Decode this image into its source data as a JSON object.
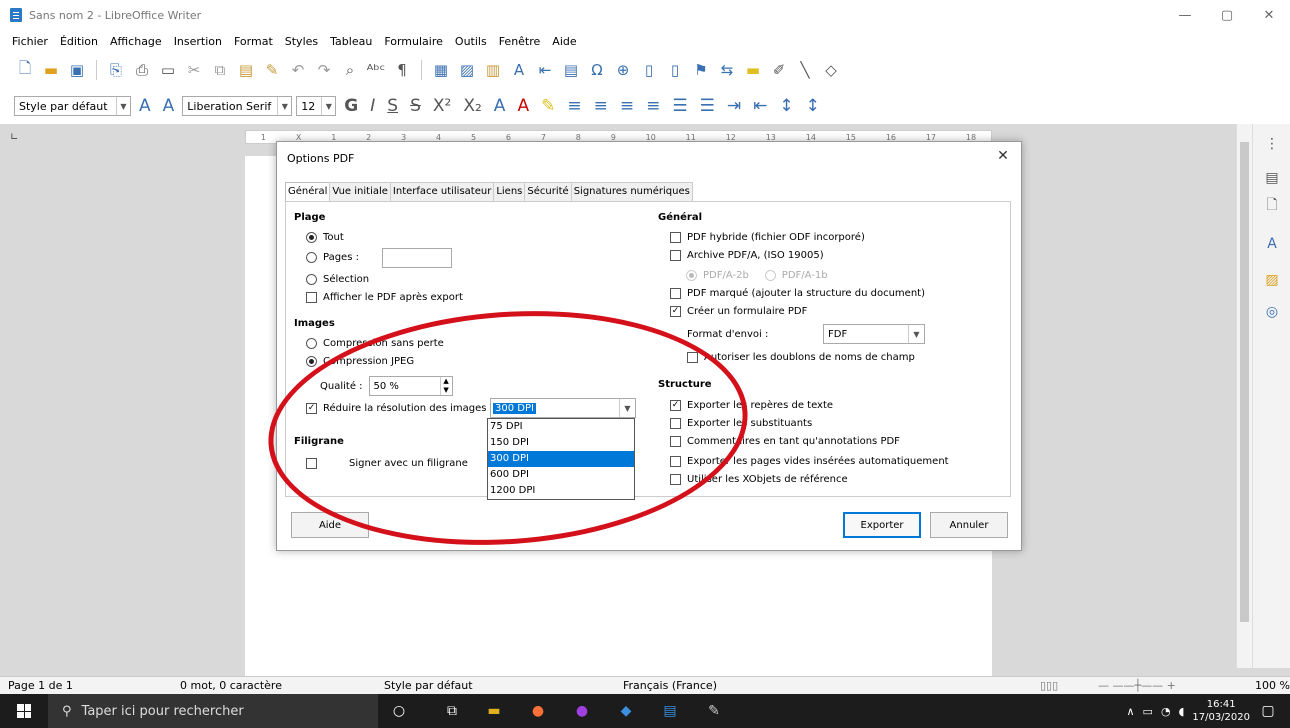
{
  "window": {
    "title": "Sans nom 2 - LibreOffice Writer",
    "min": "—",
    "max": "▢",
    "close": "✕"
  },
  "menu": [
    "Fichier",
    "Édition",
    "Affichage",
    "Insertion",
    "Format",
    "Styles",
    "Tableau",
    "Formulaire",
    "Outils",
    "Fenêtre",
    "Aide"
  ],
  "formatbar": {
    "style": "Style par défaut",
    "font": "Liberation Serif",
    "size": "12"
  },
  "ruler": [
    "1",
    "X",
    "1",
    "2",
    "3",
    "4",
    "5",
    "6",
    "7",
    "8",
    "9",
    "10",
    "11",
    "12",
    "13",
    "14",
    "15",
    "16",
    "17",
    "18"
  ],
  "dialog": {
    "title": "Options PDF",
    "tabs": [
      "Général",
      "Vue initiale",
      "Interface utilisateur",
      "Liens",
      "Sécurité",
      "Signatures numériques"
    ],
    "plage": {
      "heading": "Plage",
      "tout": "Tout",
      "pages": "Pages :",
      "selection": "Sélection",
      "afficher": "Afficher le PDF après export"
    },
    "images": {
      "heading": "Images",
      "sans_perte": "Compression sans perte",
      "jpeg": "Compression JPEG",
      "qualite_label": "Qualité :",
      "qualite_value": "50 %",
      "reduire": "Réduire la résolution des images",
      "dpi_value": "300 DPI",
      "dpi_options": [
        "75 DPI",
        "150 DPI",
        "300 DPI",
        "600 DPI",
        "1200 DPI"
      ],
      "dpi_selected_index": 2
    },
    "filigrane": {
      "heading": "Filigrane",
      "signer": "Signer avec un filigrane"
    },
    "general": {
      "heading": "Général",
      "hybride": "PDF hybride (fichier ODF incorporé)",
      "archive": "Archive PDF/A, (ISO 19005)",
      "pdfa2b": "PDF/A-2b",
      "pdfa1b": "PDF/A-1b",
      "marque": "PDF marqué (ajouter la structure du document)",
      "formulaire": "Créer un formulaire PDF",
      "format_envoi_label": "Format d'envoi :",
      "format_envoi_value": "FDF",
      "doublons": "Autoriser les doublons de noms de champ"
    },
    "structure": {
      "heading": "Structure",
      "reperes": "Exporter les repères de texte",
      "substituants": "Exporter les substituants",
      "commentaires": "Commentaires en tant qu'annotations PDF",
      "pages_vides": "Exporter les pages vides insérées automatiquement",
      "xobjets": "Utiliser les XObjets de référence"
    },
    "buttons": {
      "aide": "Aide",
      "exporter": "Exporter",
      "annuler": "Annuler"
    }
  },
  "status": {
    "page": "Page 1 de 1",
    "words": "0 mot, 0 caractère",
    "style": "Style par défaut",
    "language": "Français (France)",
    "zoom": "100 %"
  },
  "taskbar": {
    "search_placeholder": "Taper ici pour rechercher",
    "time": "16:41",
    "date": "17/03/2020"
  },
  "colors": {
    "accent": "#0078d7",
    "annotation": "#d4101a"
  }
}
